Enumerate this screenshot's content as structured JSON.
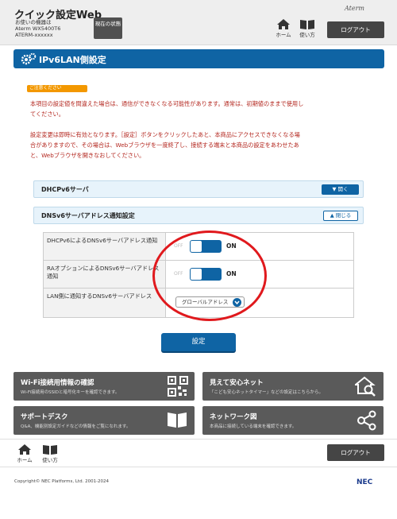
{
  "header": {
    "app_title": "クイック設定Web",
    "device_label": "お使いの機器は",
    "device_model": "Aterm WX5400T6",
    "device_id": "ATERM-xxxxxx",
    "status_button": "現在の状態",
    "logo": "Aterm",
    "home_label": "ホーム",
    "guide_label": "使い方",
    "logout_label": "ログアウト"
  },
  "page": {
    "title": "IPv6LAN側設定"
  },
  "notice": {
    "tag": "ご注意ください",
    "line1": "本項目の設定値を間違えた場合は、通信ができなくなる可能性があります。通常は、初期値のままで使用し",
    "line2": "てください。",
    "line3": "設定変更は即時に有効となります。［設定］ボタンをクリックしたあと、本商品にアクセスできなくなる場",
    "line4": "合がありますので、その場合は、Webブラウザを一度終了し、接続する端末と本商品の設定をあわせたあ",
    "line5": "と、Webブラウザを開きなおしてください。"
  },
  "sections": {
    "dhcpv6": {
      "title": "DHCPv6サーバ",
      "button": "開く"
    },
    "dnsv6": {
      "title": "DNSv6サーバアドレス通知設定",
      "button": "閉じる"
    }
  },
  "settings": {
    "row1": {
      "label": "DHCPv6によるDNSv6サーバアドレス通知",
      "off": "OFF",
      "on": "ON"
    },
    "row2": {
      "label": "RAオプションによるDNSv6サーバアドレス通知",
      "off": "OFF",
      "on": "ON"
    },
    "row3": {
      "label": "LAN側に通知するDNSv6サーバアドレス",
      "value": "グローバルアドレス"
    }
  },
  "set_button": "設定",
  "tiles": [
    {
      "title": "Wi-Fi接続用情報の確認",
      "sub": "Wi-Fi接続用のSSIDと暗号化キーを確認できます。",
      "icon": "qr-code-icon"
    },
    {
      "title": "見えて安心ネット",
      "sub": "「こども安心ネットタイマー」などの設定はこちらから。",
      "icon": "house-magnifier-icon"
    },
    {
      "title": "サポートデスク",
      "sub": "Q&A、機能別設定ガイドなどの情報をご覧になれます。",
      "icon": "book-icon"
    },
    {
      "title": "ネットワーク図",
      "sub": "本商品に接続している端末を確認できます。",
      "icon": "network-icon"
    }
  ],
  "footer": {
    "home_label": "ホーム",
    "guide_label": "使い方",
    "logout_label": "ログアウト",
    "copyright": "Copyright© NEC Platforms, Ltd. 2001-2024",
    "brand": "NEC"
  },
  "colors": {
    "primary": "#0f64a4",
    "caution": "#f39800",
    "notice_text": "#b3261e",
    "highlight": "#e0191d"
  }
}
